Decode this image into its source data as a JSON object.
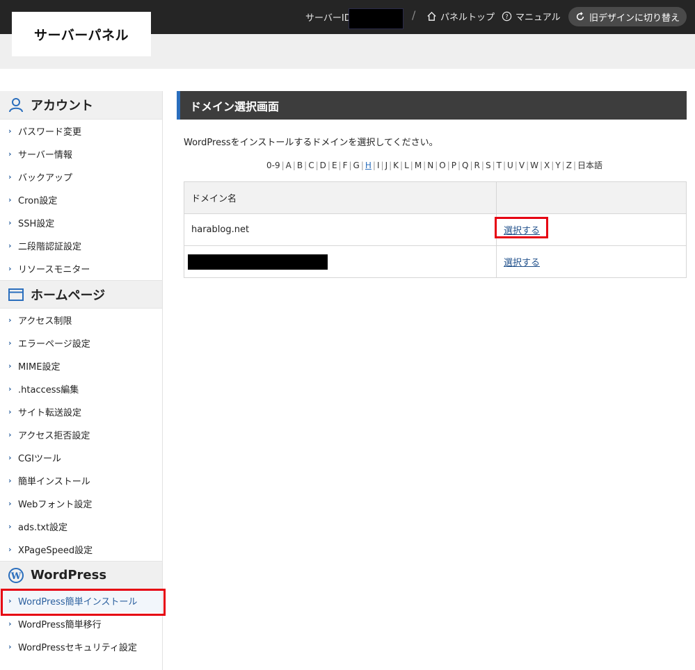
{
  "header": {
    "logo": "サーバーパネル",
    "server_id_label": "サーバーID",
    "slash": "/",
    "panel_top": "パネルトップ",
    "manual": "マニュアル",
    "old_design": "旧デザインに切り替え"
  },
  "sidebar": {
    "sections": [
      {
        "title": "アカウント",
        "icon": "user-icon",
        "items": [
          "パスワード変更",
          "サーバー情報",
          "バックアップ",
          "Cron設定",
          "SSH設定",
          "二段階認証設定",
          "リソースモニター"
        ]
      },
      {
        "title": "ホームページ",
        "icon": "browser-window-icon",
        "items": [
          ".htaccess編集",
          "アクセス制限",
          "エラーページ設定",
          "MIME設定",
          ".htaccess編集",
          "サイト転送設定",
          "アクセス拒否設定",
          "CGIツール",
          "簡単インストール",
          "Webフォント設定",
          "ads.txt設定",
          "XPageSpeed設定"
        ]
      },
      {
        "title": "WordPress",
        "icon": "wordpress-icon",
        "items": [
          "WordPress簡単インストール",
          "WordPress簡単移行",
          "WordPressセキュリティ設定"
        ]
      }
    ],
    "active_item": "WordPress簡単インストール"
  },
  "main": {
    "title": "ドメイン選択画面",
    "description": "WordPressをインストールするドメインを選択してください。",
    "alphabet": [
      "0-9",
      "A",
      "B",
      "C",
      "D",
      "E",
      "F",
      "G",
      "H",
      "I",
      "J",
      "K",
      "L",
      "M",
      "N",
      "O",
      "P",
      "Q",
      "R",
      "S",
      "T",
      "U",
      "V",
      "W",
      "X",
      "Y",
      "Z",
      "日本語"
    ],
    "alphabet_current": "H",
    "table": {
      "headers": [
        "ドメイン名",
        ""
      ],
      "rows": [
        {
          "domain": "harablog.net",
          "action": "選択する"
        },
        {
          "domain": "",
          "action": "選択する"
        }
      ]
    }
  },
  "colors": {
    "topbar": "#252525",
    "accent": "#2a6ebd",
    "highlight": "#e60012",
    "link": "#1f4f8a"
  }
}
